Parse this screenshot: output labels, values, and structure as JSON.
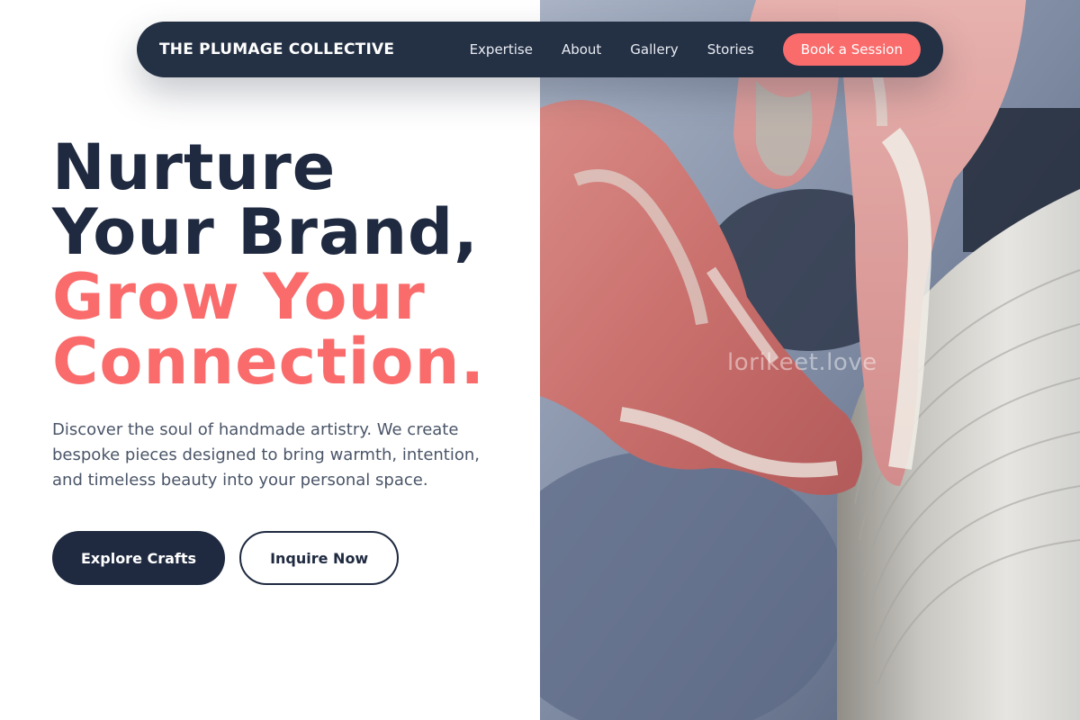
{
  "nav": {
    "brand": "THE PLUMAGE COLLECTIVE",
    "links": [
      "Expertise",
      "About",
      "Gallery",
      "Stories"
    ],
    "cta": "Book a Session"
  },
  "hero": {
    "headline_line1": "Nurture",
    "headline_line2": "Your Brand,",
    "headline_line3": "Grow Your",
    "headline_line4": "Connection.",
    "description": "Discover the soul of handmade artistry. We create bespoke pieces designed to bring warmth, intention, and timeless beauty into your personal space.",
    "primary_button": "Explore Crafts",
    "secondary_button": "Inquire Now",
    "image_watermark": "lorikeet.love"
  },
  "colors": {
    "nav_background": "#243044",
    "accent": "#fa6b6b",
    "heading_dark": "#1f2a40",
    "body_text": "#4a5568"
  }
}
